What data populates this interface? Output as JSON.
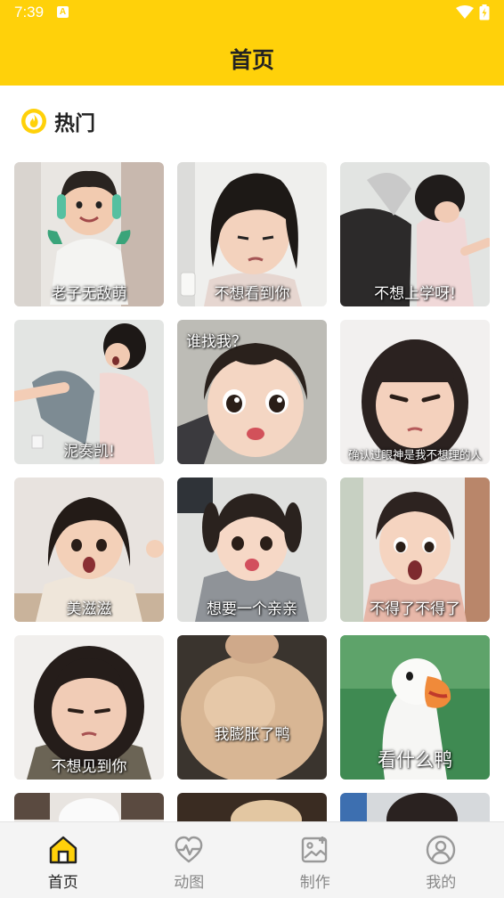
{
  "status_bar": {
    "time": "7:39",
    "notification_letter": "A"
  },
  "header": {
    "title": "首页"
  },
  "section": {
    "title": "热门",
    "icon": "flame-icon"
  },
  "tiles": [
    {
      "caption": "老子无敌萌"
    },
    {
      "caption": "不想看到你"
    },
    {
      "caption": "不想上学呀!"
    },
    {
      "caption": "泥奏凯!"
    },
    {
      "caption": "谁找我？"
    },
    {
      "caption": "确认过眼神是我不想理的人"
    },
    {
      "caption": "美滋滋"
    },
    {
      "caption": "想要一个亲亲"
    },
    {
      "caption": "不得了不得了"
    },
    {
      "caption": "不想见到你"
    },
    {
      "caption": "我膨胀了鸭"
    },
    {
      "caption": "看什么鸭"
    },
    {
      "caption": ""
    },
    {
      "caption": ""
    },
    {
      "caption": ""
    }
  ],
  "tab_bar": {
    "accent": "#FFD10A",
    "tabs": [
      {
        "label": "首页",
        "icon": "home-icon",
        "active": true
      },
      {
        "label": "动图",
        "icon": "heart-pulse-icon",
        "active": false
      },
      {
        "label": "制作",
        "icon": "image-edit-icon",
        "active": false
      },
      {
        "label": "我的",
        "icon": "user-icon",
        "active": false
      }
    ]
  }
}
